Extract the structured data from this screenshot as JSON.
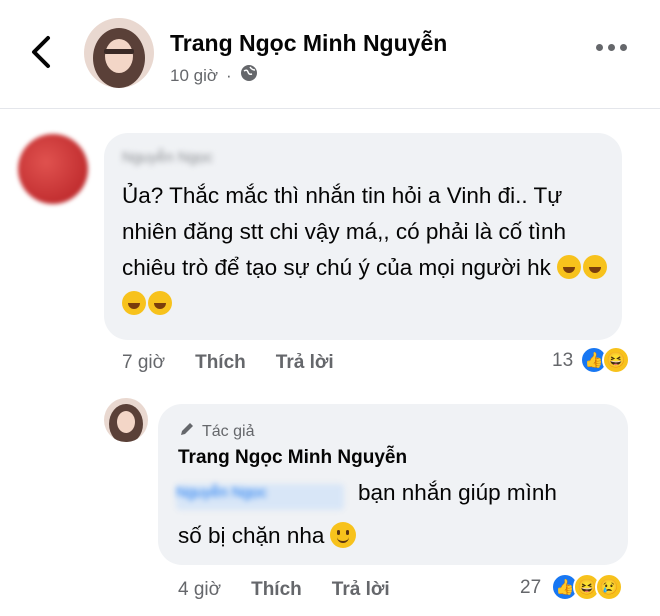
{
  "header": {
    "poster_name": "Trang Ngọc Minh Nguyễn",
    "post_time": "10 giờ",
    "icons": {
      "back": "chevron-left-icon",
      "privacy": "globe-icon",
      "more": "more-dots-icon"
    }
  },
  "comment": {
    "author_name": "Nguyễn Ngọc",
    "text": "Ủa? Thắc mắc thì nhắn tin hỏi a Vinh đi..  Tự nhiên đăng stt chi vậy má,, có phải là cố tình chiêu trò để tạo sự chú ý của mọi người hk",
    "time": "7 giờ",
    "like_label": "Thích",
    "reply_label": "Trả lời",
    "reaction_count": "13",
    "reactions": [
      "like",
      "haha"
    ]
  },
  "reply": {
    "badge": "Tác giả",
    "author_name": "Trang Ngọc Minh Nguyễn",
    "mention": "Nguyễn Ngọc",
    "line1": "bạn nhắn giúp mình",
    "line2": "số bị chặn nha",
    "time": "4 giờ",
    "like_label": "Thích",
    "reply_label": "Trả lời",
    "reaction_count": "27",
    "reactions": [
      "like",
      "haha",
      "sad"
    ]
  },
  "colors": {
    "link_blue": "#1877f2",
    "bubble_bg": "#f0f2f5",
    "meta_gray": "#65676b"
  }
}
